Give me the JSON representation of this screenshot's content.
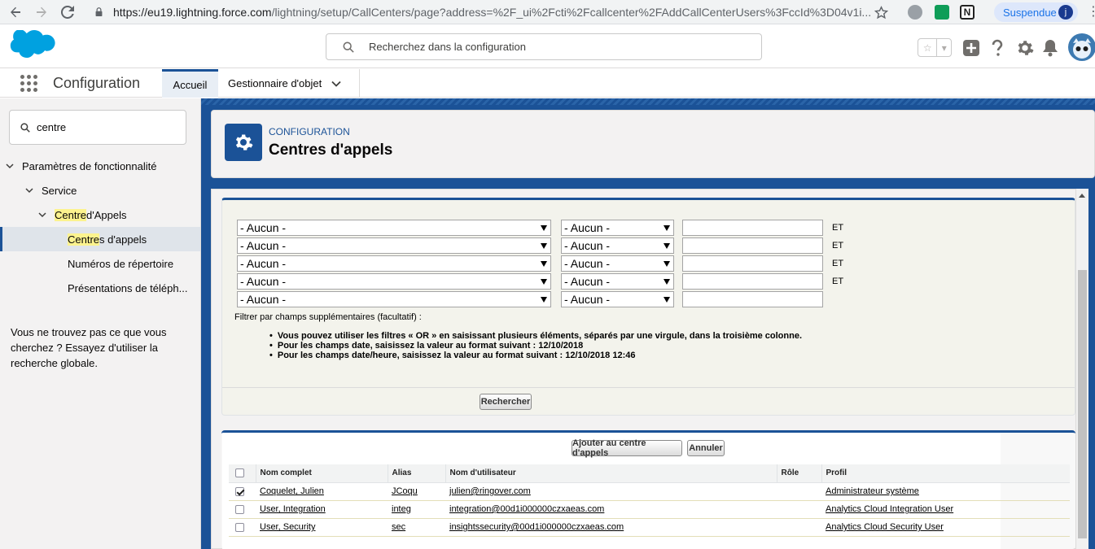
{
  "browser": {
    "url_host": "https://eu19.lightning.force.com",
    "url_rest": "/lightning/setup/CallCenters/page?address=%2F_ui%2Fcti%2Fcallcenter%2FAddCallCenterUsers%3FccId%3D04v1i...",
    "profile_label": "Suspendue",
    "profile_initial": "j"
  },
  "header": {
    "search_placeholder": "Recherchez dans la configuration"
  },
  "nav": {
    "app_name": "Configuration",
    "tabs": [
      {
        "label": "Accueil"
      },
      {
        "label": "Gestionnaire d'objet"
      }
    ]
  },
  "sidebar": {
    "quickfind_value": "centre",
    "tree": [
      {
        "label": "Paramètres de fonctionnalité"
      },
      {
        "label": "Service"
      },
      {
        "label_hl": "Centre",
        "label_rest": " d'Appels"
      },
      {
        "label_hl": "Centre",
        "label_rest": "s d'appels"
      },
      {
        "label": "Numéros de répertoire"
      },
      {
        "label": "Présentations de téléph..."
      }
    ],
    "not_found": "Vous ne trouvez pas ce que vous cherchez ? Essayez d'utiliser la recherche globale."
  },
  "page": {
    "eyebrow": "CONFIGURATION",
    "title": "Centres d'appels"
  },
  "filters": {
    "field_default": "- Aucun -",
    "operator_default": "- Aucun -",
    "and_label": "ET",
    "note": "Filtrer par champs supplémentaires (facultatif)  :",
    "bullets": [
      "Vous pouvez utiliser les filtres « OR » en saisissant plusieurs éléments, séparés par une virgule, dans la troisième colonne.",
      "Pour les champs date, saisissez la valeur au format suivant : 12/10/2018",
      "Pour les champs date/heure, saisissez la valeur au format suivant : 12/10/2018 12:46"
    ],
    "search_button": "Rechercher"
  },
  "results": {
    "add_button": "Ajouter au centre d'appels",
    "cancel_button": "Annuler",
    "columns": [
      "Nom complet",
      "Alias",
      "Nom d'utilisateur",
      "Rôle",
      "Profil"
    ],
    "rows": [
      {
        "checked": true,
        "name": "Coquelet, Julien",
        "alias": "JCoqu",
        "username": "julien@ringover.com",
        "role": "",
        "profile": "Administrateur système"
      },
      {
        "checked": false,
        "name": "User, Integration",
        "alias": "integ",
        "username": "integration@00d1i000000czxaeas.com",
        "role": "",
        "profile": "Analytics Cloud Integration User"
      },
      {
        "checked": false,
        "name": "User, Security",
        "alias": "sec",
        "username": "insightssecurity@00d1i000000czxaeas.com",
        "role": "",
        "profile": "Analytics Cloud Security User"
      }
    ]
  },
  "colors": {
    "brand": "#1b5297",
    "sf_blue": "#00a1e0"
  }
}
